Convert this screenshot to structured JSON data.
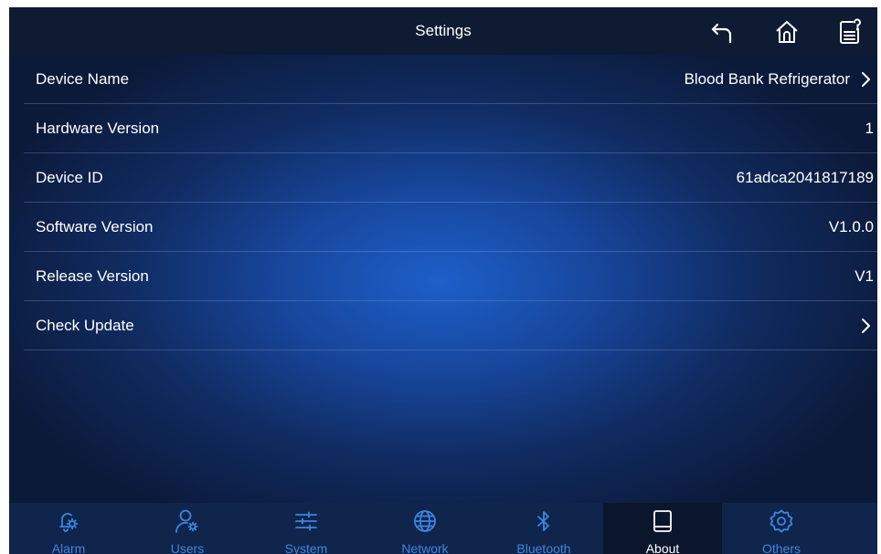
{
  "header": {
    "title": "Settings",
    "icons": [
      "back-arrow-icon",
      "home-icon",
      "help-document-icon"
    ]
  },
  "about_rows": [
    {
      "label": "Device Name",
      "value": "Blood Bank Refrigerator",
      "chevron": true
    },
    {
      "label": "Hardware Version",
      "value": "1",
      "chevron": false
    },
    {
      "label": "Device ID",
      "value": "61adca2041817189",
      "chevron": false
    },
    {
      "label": "Software Version",
      "value": "V1.0.0",
      "chevron": false
    },
    {
      "label": "Release Version",
      "value": "V1",
      "chevron": false
    },
    {
      "label": "Check Update",
      "value": "",
      "chevron": true
    }
  ],
  "tabs": [
    {
      "label": "Alarm",
      "icon": "alarm-bell-gear-icon",
      "active": false
    },
    {
      "label": "Users",
      "icon": "user-gear-icon",
      "active": false
    },
    {
      "label": "System",
      "icon": "sliders-icon",
      "active": false
    },
    {
      "label": "Network",
      "icon": "globe-icon",
      "active": false
    },
    {
      "label": "Bluetooth",
      "icon": "bluetooth-icon",
      "active": false
    },
    {
      "label": "About",
      "icon": "tablet-icon",
      "active": true
    },
    {
      "label": "Others",
      "icon": "gear-icon",
      "active": false
    }
  ],
  "colors": {
    "tab_inactive": "#3d86e0",
    "tab_active_text": "#ffffff",
    "topbar": "#0e1b33"
  }
}
